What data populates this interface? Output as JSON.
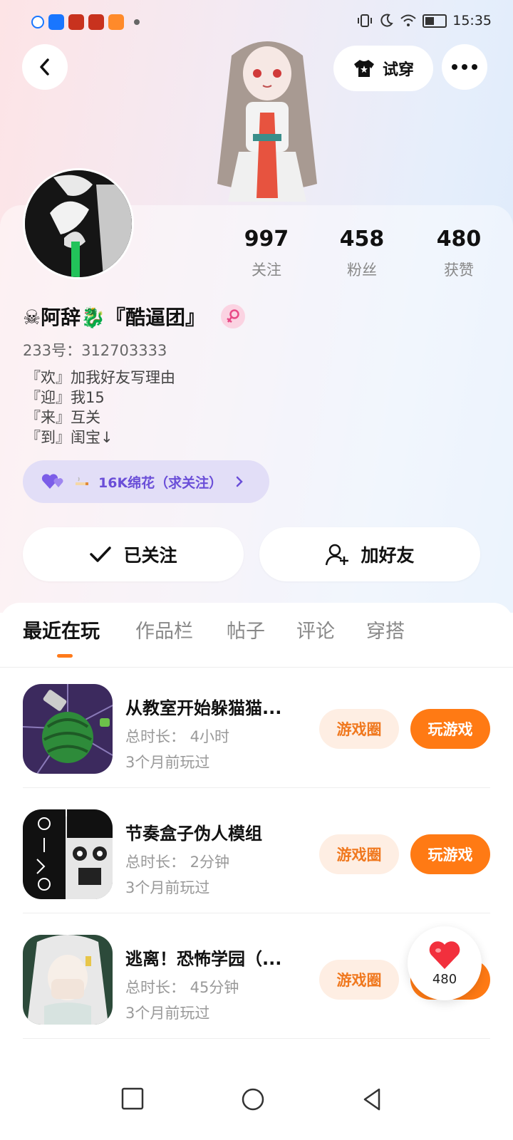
{
  "status_bar": {
    "time": "15:35",
    "apps": [
      "search-app-icon",
      "shield-app-icon",
      "game-app-icon-1",
      "game-app-icon-2",
      "bag-app-icon"
    ]
  },
  "header": {
    "try_on_label": "试穿"
  },
  "profile": {
    "stats": [
      {
        "value": "997",
        "label": "关注"
      },
      {
        "value": "458",
        "label": "粉丝"
      },
      {
        "value": "480",
        "label": "获赞"
      }
    ],
    "name": "☠阿辞🐉『酷逼团』",
    "id_line": "233号：312703333",
    "bio": [
      "『欢』加我好友写理由",
      "『迎』我15",
      "『来』互关",
      "『到』闺宝↓"
    ],
    "cotton_label": "16K绵花（求关注）",
    "follow_label": "已关注",
    "add_friend_label": "加好友"
  },
  "tabs": [
    {
      "label": "最近在玩",
      "active": true
    },
    {
      "label": "作品栏",
      "active": false
    },
    {
      "label": "帖子",
      "active": false
    },
    {
      "label": "评论",
      "active": false
    },
    {
      "label": "穿搭",
      "active": false
    }
  ],
  "games": [
    {
      "title": "从教室开始躲猫猫...",
      "duration": "总时长：  4小时",
      "last_played": "3个月前玩过",
      "circle_label": "游戏圈",
      "play_label": "玩游戏"
    },
    {
      "title": "节奏盒子伪人模组",
      "duration": "总时长：  2分钟",
      "last_played": "3个月前玩过",
      "circle_label": "游戏圈",
      "play_label": "玩游戏"
    },
    {
      "title": "逃离！恐怖学园（...",
      "duration": "总时长：  45分钟",
      "last_played": "3个月前玩过",
      "circle_label": "游戏圈",
      "play_label": "玩游戏"
    }
  ],
  "floating_like": {
    "count": "480"
  },
  "colors": {
    "accent": "#ff7a14",
    "accent_light": "#feeee3",
    "cotton_text": "#6a4ed8"
  }
}
